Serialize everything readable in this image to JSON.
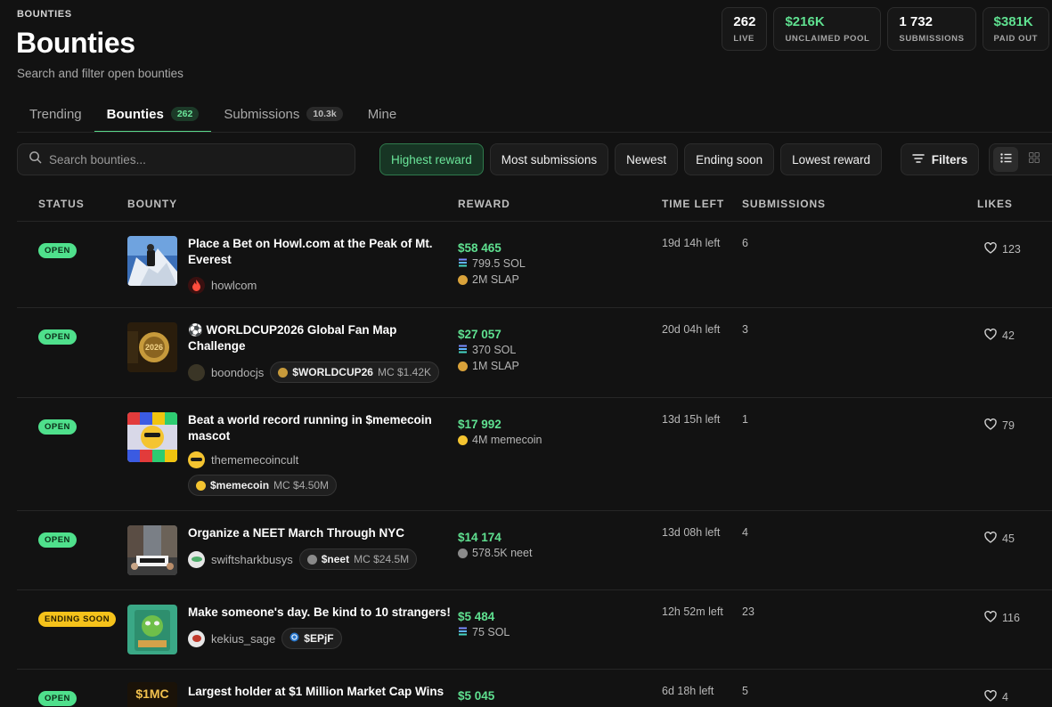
{
  "header": {
    "eyebrow": "BOUNTIES",
    "title": "Bounties",
    "subtitle": "Search and filter open bounties"
  },
  "stats": [
    {
      "value": "262",
      "label": "LIVE",
      "color": "#ffffff"
    },
    {
      "value": "$216K",
      "label": "UNCLAIMED POOL",
      "color": "#5fe090"
    },
    {
      "value": "1 732",
      "label": "SUBMISSIONS",
      "color": "#ffffff"
    },
    {
      "value": "$381K",
      "label": "PAID OUT",
      "color": "#5fe090"
    }
  ],
  "tabs": [
    {
      "label": "Trending",
      "count": null,
      "active": false
    },
    {
      "label": "Bounties",
      "count": "262",
      "active": true
    },
    {
      "label": "Submissions",
      "count": "10.3k",
      "active": false
    },
    {
      "label": "Mine",
      "count": null,
      "active": false
    }
  ],
  "search": {
    "placeholder": "Search bounties...",
    "value": "",
    "icon": "search-icon"
  },
  "sort_chips": [
    {
      "label": "Highest reward",
      "active": true
    },
    {
      "label": "Most submissions",
      "active": false
    },
    {
      "label": "Newest",
      "active": false
    },
    {
      "label": "Ending soon",
      "active": false
    },
    {
      "label": "Lowest reward",
      "active": false
    }
  ],
  "filters": {
    "label": "Filters",
    "icon": "filter-icon"
  },
  "view_toggle": {
    "selected": "list",
    "options": [
      "list-view-icon",
      "grid-view-icon"
    ]
  },
  "table": {
    "headers": {
      "status": "STATUS",
      "bounty": "BOUNTY",
      "reward": "REWARD",
      "time_left": "TIME LEFT",
      "submissions": "SUBMISSIONS",
      "likes": "LIKES"
    },
    "rows": [
      {
        "status": "OPEN",
        "title": "Place a Bet on Howl.com at the Peak of Mt. Everest",
        "author": "howlcom",
        "tags": [],
        "reward_usd": "$58 465",
        "reward_tokens": [
          {
            "text": "799.5 SOL",
            "icon": "sol-icon"
          },
          {
            "text": "2M SLAP",
            "icon": "slap-icon"
          }
        ],
        "time_left": "19d 14h left",
        "submissions": "6",
        "likes": "123"
      },
      {
        "status": "OPEN",
        "title": "⚽ WORLDCUP2026 Global Fan Map Challenge",
        "author": "boondocjs",
        "tags": [
          {
            "name": "$WORLDCUP26",
            "mc": "MC $1.42K"
          }
        ],
        "reward_usd": "$27 057",
        "reward_tokens": [
          {
            "text": "370 SOL",
            "icon": "sol-icon"
          },
          {
            "text": "1M SLAP",
            "icon": "slap-icon"
          }
        ],
        "time_left": "20d 04h left",
        "submissions": "3",
        "likes": "42"
      },
      {
        "status": "OPEN",
        "title": "Beat a world record running in $memecoin mascot",
        "author": "thememecoincult",
        "tags": [
          {
            "name": "$memecoin",
            "mc": "MC $4.50M"
          }
        ],
        "reward_usd": "$17 992",
        "reward_tokens": [
          {
            "text": "4M memecoin",
            "icon": "memecoin-icon"
          }
        ],
        "time_left": "13d 15h left",
        "submissions": "1",
        "likes": "79"
      },
      {
        "status": "OPEN",
        "title": "Organize a NEET March Through NYC",
        "author": "swiftsharkbusys",
        "tags": [
          {
            "name": "$neet",
            "mc": "MC $24.5M"
          }
        ],
        "reward_usd": "$14 174",
        "reward_tokens": [
          {
            "text": "578.5K neet",
            "icon": "neet-icon"
          }
        ],
        "time_left": "13d 08h left",
        "submissions": "4",
        "likes": "45"
      },
      {
        "status": "ENDING SOON",
        "title": "Make someone's day. Be kind to 10 strangers!",
        "author": "kekius_sage",
        "tags": [
          {
            "name": "$EPjF",
            "mc": ""
          }
        ],
        "reward_usd": "$5 484",
        "reward_tokens": [
          {
            "text": "75 SOL",
            "icon": "sol-icon"
          }
        ],
        "time_left": "12h 52m left",
        "submissions": "23",
        "likes": "116"
      },
      {
        "status": "OPEN",
        "title": "Largest holder at $1 Million Market Cap Wins",
        "author": "",
        "tags": [],
        "reward_usd": "$5 045",
        "reward_tokens": [],
        "time_left": "6d 18h left",
        "submissions": "5",
        "likes": "4"
      }
    ]
  },
  "thumbnail_texts": {
    "row2": "2026",
    "row6": "$1MC"
  },
  "colors": {
    "accent": "#5fe090",
    "open_badge": "#4fe08c",
    "ending_badge": "#f5c21b",
    "background": "#121212"
  }
}
